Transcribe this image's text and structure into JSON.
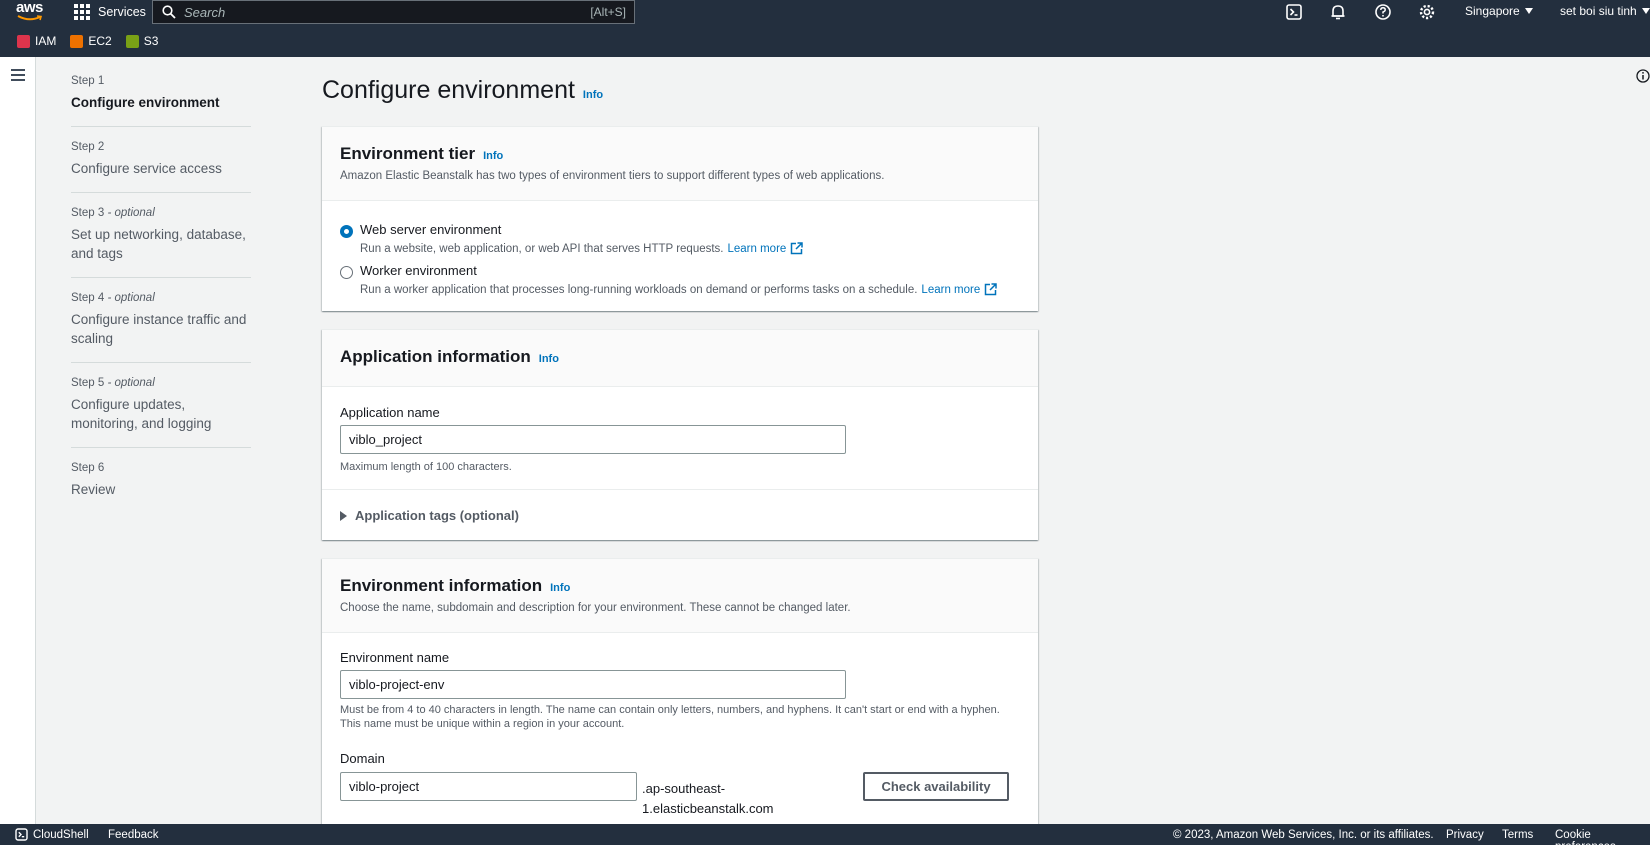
{
  "topnav": {
    "logo_text": "aws",
    "services_label": "Services",
    "search_placeholder": "Search",
    "search_shortcut": "[Alt+S]",
    "region": "Singapore",
    "user": "set boi siu tinh",
    "favorites": [
      {
        "label": "IAM",
        "color": "#dd344c"
      },
      {
        "label": "EC2",
        "color": "#ed7100"
      },
      {
        "label": "S3",
        "color": "#7aa116"
      }
    ]
  },
  "steps": [
    {
      "num": "Step 1",
      "optional": "",
      "name": "Configure environment",
      "active": true
    },
    {
      "num": "Step 2",
      "optional": "",
      "name": "Configure service access",
      "active": false
    },
    {
      "num": "Step 3",
      "optional": " - optional",
      "name": "Set up networking, database, and tags",
      "active": false
    },
    {
      "num": "Step 4",
      "optional": " - optional",
      "name": "Configure instance traffic and scaling",
      "active": false
    },
    {
      "num": "Step 5",
      "optional": " - optional",
      "name": "Configure updates, monitoring, and logging",
      "active": false
    },
    {
      "num": "Step 6",
      "optional": "",
      "name": "Review",
      "active": false
    }
  ],
  "page": {
    "title": "Configure environment",
    "info": "Info"
  },
  "tier": {
    "title": "Environment tier",
    "info": "Info",
    "desc": "Amazon Elastic Beanstalk has two types of environment tiers to support different types of web applications.",
    "options": [
      {
        "label": "Web server environment",
        "sub": "Run a website, web application, or web API that serves HTTP requests.",
        "learn": "Learn more",
        "selected": true
      },
      {
        "label": "Worker environment",
        "sub": "Run a worker application that processes long-running workloads on demand or performs tasks on a schedule.",
        "learn": "Learn more",
        "selected": false
      }
    ]
  },
  "app": {
    "title": "Application information",
    "info": "Info",
    "name_label": "Application name",
    "name_value": "viblo_project",
    "name_hint": "Maximum length of 100 characters.",
    "tags_label": "Application tags (optional)"
  },
  "env": {
    "title": "Environment information",
    "info": "Info",
    "desc": "Choose the name, subdomain and description for your environment. These cannot be changed later.",
    "name_label": "Environment name",
    "name_value": "viblo-project-env",
    "name_hint1": "Must be from 4 to 40 characters in length. The name can contain only letters, numbers, and hyphens. It can't start or end with a hyphen.",
    "name_hint2": "This name must be unique within a region in your account.",
    "domain_label": "Domain",
    "domain_value": "viblo-project",
    "domain_suffix1": ".ap-southeast-",
    "domain_suffix2": "1.elasticbeanstalk.com",
    "check_label": "Check availability"
  },
  "footer": {
    "cloudshell": "CloudShell",
    "feedback": "Feedback",
    "copyright": "© 2023, Amazon Web Services, Inc. or its affiliates.",
    "privacy": "Privacy",
    "terms": "Terms",
    "cookie": "Cookie preferences"
  },
  "colors": {
    "nav_bg": "#232f3e",
    "link": "#0073bb",
    "page_bg": "#f2f3f3"
  }
}
